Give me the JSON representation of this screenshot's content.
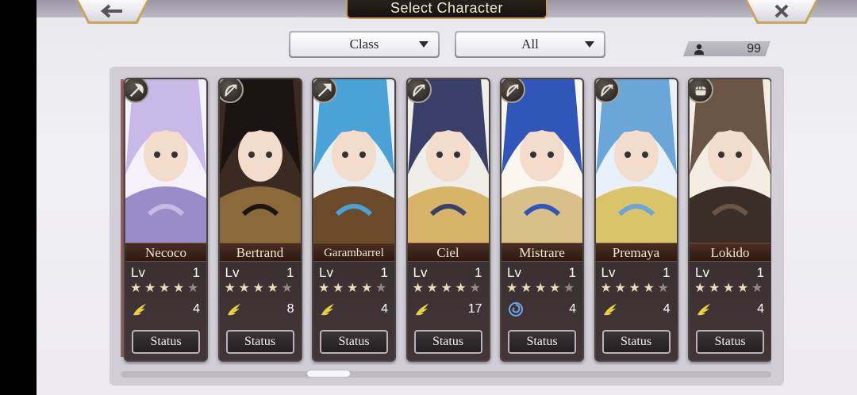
{
  "header": {
    "title": "Select Character"
  },
  "filters": {
    "class_label": "Class",
    "all_label": "All"
  },
  "owned_count": "99",
  "characters": [
    {
      "name": "Necoco",
      "lv_label": "Lv",
      "level": "1",
      "stars": 4,
      "element": "wind-wing-icon",
      "count": "4",
      "status": "Status",
      "class_icon": "axe-icon",
      "palette": [
        "#f4f1fa",
        "#c8b9e8",
        "#9a8cc8"
      ]
    },
    {
      "name": "Bertrand",
      "lv_label": "Lv",
      "level": "1",
      "stars": 4,
      "element": "wind-wing-icon",
      "count": "8",
      "status": "Status",
      "class_icon": "bow-icon",
      "palette": [
        "#3a2a22",
        "#1c1412",
        "#8a6a3a"
      ]
    },
    {
      "name": "Garambarrel",
      "lv_label": "Lv",
      "level": "1",
      "stars": 4,
      "element": "wind-wing-icon",
      "count": "4",
      "status": "Status",
      "class_icon": "spear-icon",
      "palette": [
        "#e9f0f5",
        "#4aa2d6",
        "#6b4a2a"
      ]
    },
    {
      "name": "Ciel",
      "lv_label": "Lv",
      "level": "1",
      "stars": 4,
      "element": "wind-wing-icon",
      "count": "17",
      "status": "Status",
      "class_icon": "bow-icon",
      "palette": [
        "#f0eee8",
        "#3a3f6a",
        "#d7b468"
      ]
    },
    {
      "name": "Mistrare",
      "lv_label": "Lv",
      "level": "1",
      "stars": 4,
      "element": "water-swirl-icon",
      "count": "4",
      "status": "Status",
      "class_icon": "bow-icon",
      "palette": [
        "#fbf7f0",
        "#2f56b8",
        "#d9c08a"
      ]
    },
    {
      "name": "Premaya",
      "lv_label": "Lv",
      "level": "1",
      "stars": 4,
      "element": "wind-wing-icon",
      "count": "4",
      "status": "Status",
      "class_icon": "bow-icon",
      "palette": [
        "#e8f0fa",
        "#6aa6d8",
        "#d9c46a"
      ]
    },
    {
      "name": "Lokido",
      "lv_label": "Lv",
      "level": "1",
      "stars": 4,
      "element": "wind-wing-icon",
      "count": "4",
      "status": "Status",
      "class_icon": "fist-icon",
      "palette": [
        "#f4ede3",
        "#6b5546",
        "#3a2e28"
      ]
    }
  ]
}
